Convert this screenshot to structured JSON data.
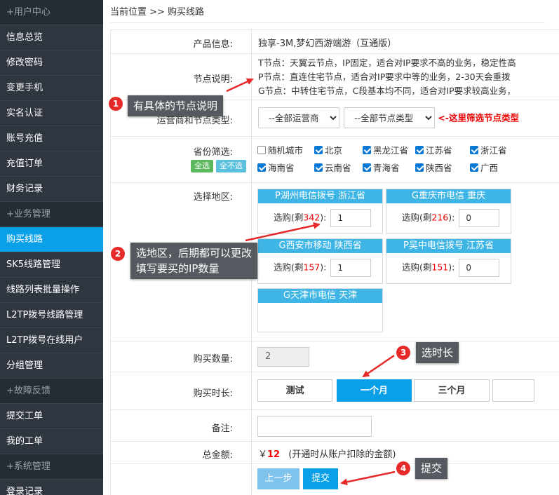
{
  "sidebar": {
    "items": [
      {
        "label": "+用户中心",
        "type": "group"
      },
      {
        "label": "信息总览",
        "type": "item"
      },
      {
        "label": "修改密码",
        "type": "item"
      },
      {
        "label": "变更手机",
        "type": "item"
      },
      {
        "label": "实名认证",
        "type": "item"
      },
      {
        "label": "账号充值",
        "type": "item"
      },
      {
        "label": "充值订单",
        "type": "item"
      },
      {
        "label": "财务记录",
        "type": "item"
      },
      {
        "label": "+业务管理",
        "type": "group"
      },
      {
        "label": "购买线路",
        "type": "active"
      },
      {
        "label": "SK5线路管理",
        "type": "item"
      },
      {
        "label": "线路列表批量操作",
        "type": "item"
      },
      {
        "label": "L2TP拨号线路管理",
        "type": "item"
      },
      {
        "label": "L2TP拨号在线用户",
        "type": "item"
      },
      {
        "label": "分组管理",
        "type": "item"
      },
      {
        "label": "+故障反馈",
        "type": "group"
      },
      {
        "label": "提交工单",
        "type": "item"
      },
      {
        "label": "我的工单",
        "type": "item"
      },
      {
        "label": "+系统管理",
        "type": "group"
      },
      {
        "label": "登录记录",
        "type": "item"
      }
    ]
  },
  "breadcrumb": "当前位置 >> 购买线路",
  "form": {
    "product": {
      "label": "产品信息:",
      "value": "独享-3M,梦幻西游端游（互通版）"
    },
    "nodes": {
      "label": "节点说明:",
      "lines": [
        "T节点：天翼云节点，IP固定，适合对IP要求不高的业务，稳定性高",
        "P节点：直连住宅节点，适合对IP要求中等的业务，2-30天会重拨",
        "G节点：中转住宅节点，C段基本均不同，适合对IP要求较高业务，"
      ]
    },
    "filter": {
      "label": "运营商和节点类型:",
      "carrier": "--全部运营商",
      "node_type": "--全部节点类型",
      "hint": "<-这里筛选节点类型"
    },
    "province": {
      "label": "省份筛选:",
      "select_all": "全选",
      "select_none": "全不选",
      "row1": [
        {
          "name": "随机城市",
          "checked": false
        },
        {
          "name": "北京",
          "checked": true
        },
        {
          "name": "黑龙江省",
          "checked": true
        },
        {
          "name": "江苏省",
          "checked": true
        },
        {
          "name": "浙江省",
          "checked": true
        }
      ],
      "row2": [
        {
          "name": "海南省",
          "checked": true
        },
        {
          "name": "云南省",
          "checked": true
        },
        {
          "name": "青海省",
          "checked": true
        },
        {
          "name": "陕西省",
          "checked": true
        },
        {
          "name": "广西",
          "checked": true
        }
      ]
    },
    "region": {
      "label": "选择地区:",
      "qty_prefix": "选购(剩",
      "qty_suffix": "):",
      "cards": [
        {
          "title": "P湖州电信拨号 浙江省",
          "remaining": "342",
          "qty": "1"
        },
        {
          "title": "G重庆市电信 重庆",
          "remaining": "216",
          "qty": "0"
        },
        {
          "title": "G西安市移动 陕西省",
          "remaining": "157",
          "qty": "1"
        },
        {
          "title": "P吴中电信拨号 江苏省",
          "remaining": "151",
          "qty": "0"
        },
        {
          "title": "G天津市电信 天津"
        }
      ]
    },
    "quantity": {
      "label": "购买数量:",
      "value": "2"
    },
    "duration": {
      "label": "购买时长:",
      "options": [
        "测试",
        "一个月",
        "三个月"
      ],
      "selected": "一个月"
    },
    "note": {
      "label": "备注:",
      "value": ""
    },
    "total": {
      "label": "总金额:",
      "currency": "￥",
      "amount": "12",
      "desc": "(开通时从账户扣除的金额)"
    },
    "actions": {
      "prev": "上一步",
      "submit": "提交"
    }
  },
  "annotations": [
    {
      "num": "1",
      "text": "有具体的节点说明"
    },
    {
      "num": "2",
      "text_lines": [
        "选地区，后期都可以更改",
        "填写要买的IP数量"
      ]
    },
    {
      "num": "3",
      "text": "选时长"
    },
    {
      "num": "4",
      "text": "提交"
    }
  ],
  "colors": {
    "accent": "#0aa0e8",
    "card_header": "#3eb5e5",
    "sidebar": "#2f3640",
    "warning": "#e00000",
    "callout": "#545a60",
    "badge": "#e62a2a"
  }
}
